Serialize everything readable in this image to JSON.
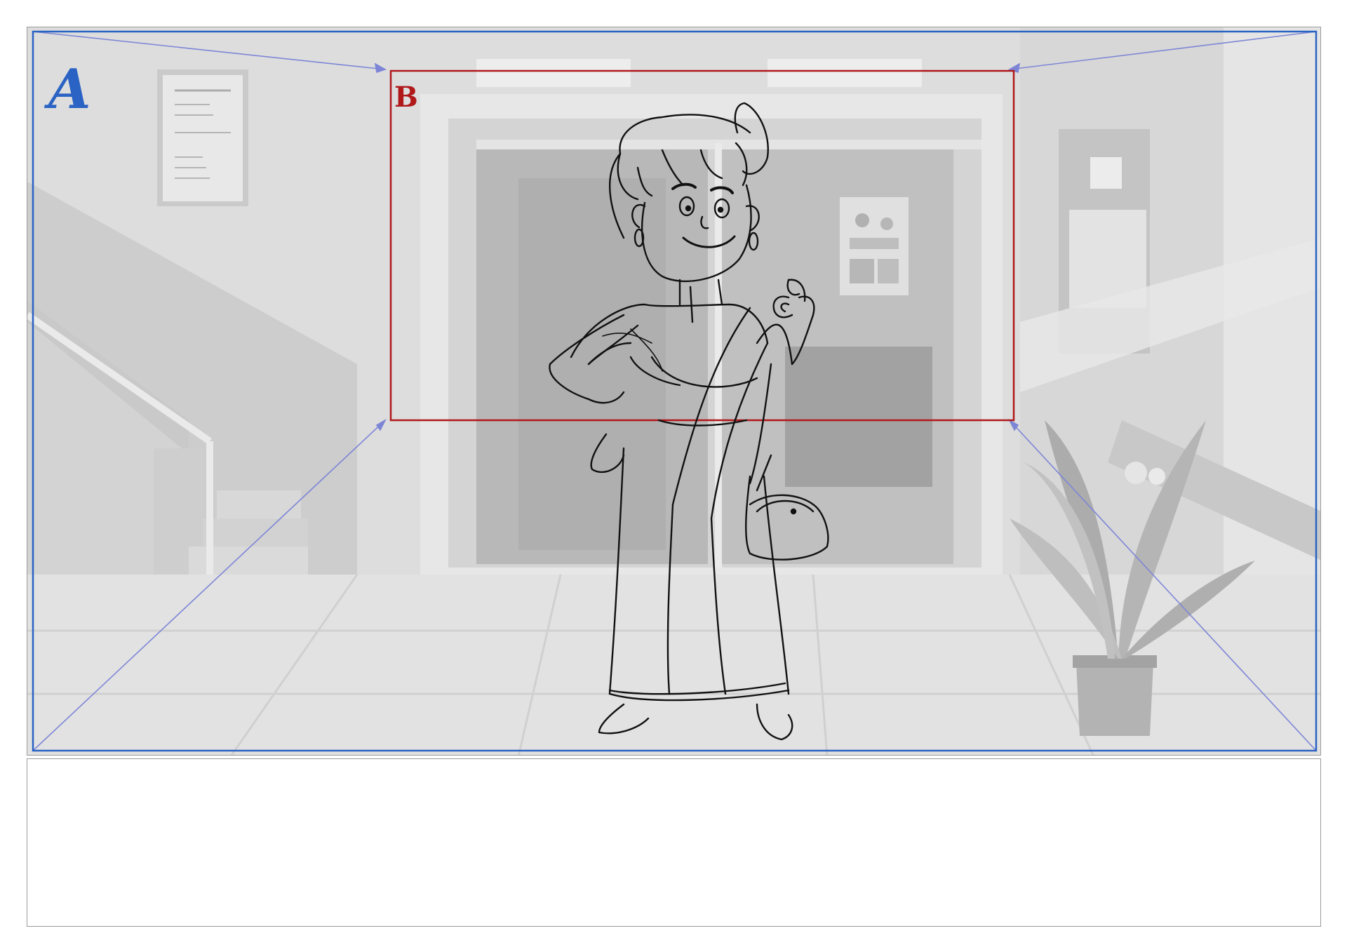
{
  "storyboard": {
    "frame_labels": {
      "wide": "A",
      "close": "B"
    },
    "colors": {
      "frame_a": "#2a63c4",
      "frame_b": "#b0181a",
      "camera_move_lines": "#7d86d6",
      "sketch_ink": "#111111",
      "background_tint": "#cfcfcf"
    },
    "icons": [
      "character-sketch",
      "potted-plant",
      "poster",
      "staircase",
      "double-doors"
    ],
    "notes": ""
  }
}
